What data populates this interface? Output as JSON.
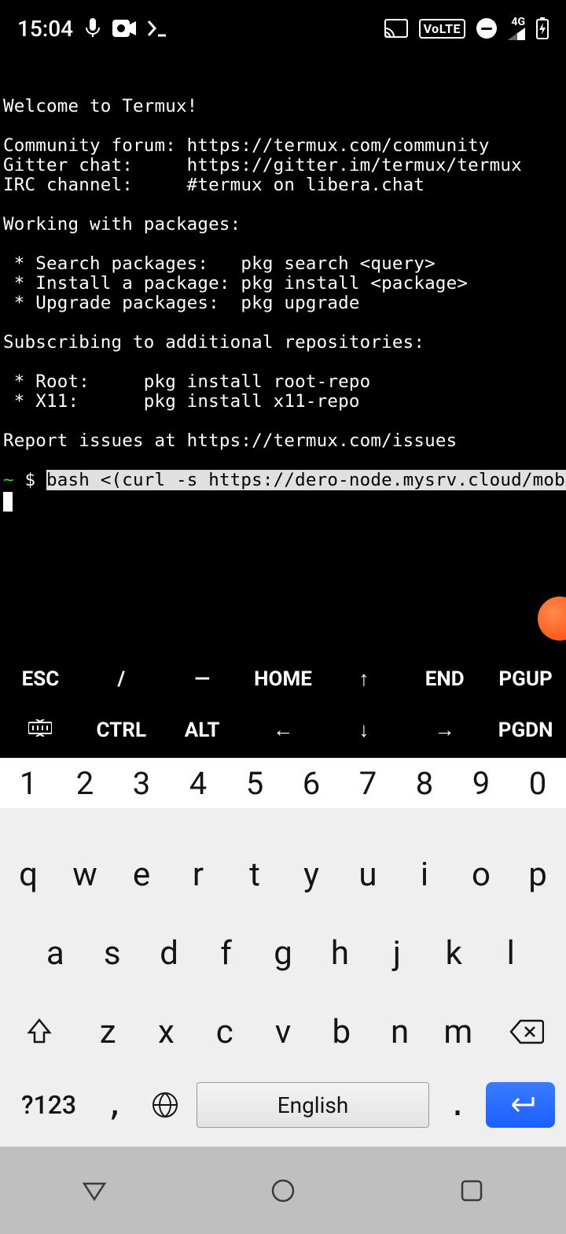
{
  "status": {
    "time": "15:04",
    "volte": "VoLTE",
    "network": "4G"
  },
  "terminal": {
    "lines": [
      "Welcome to Termux!",
      "",
      "Community forum: https://termux.com/community",
      "Gitter chat:     https://gitter.im/termux/termux",
      "IRC channel:     #termux on libera.chat",
      "",
      "Working with packages:",
      "",
      " * Search packages:   pkg search <query>",
      " * Install a package: pkg install <package>",
      " * Upgrade packages:  pkg upgrade",
      "",
      "Subscribing to additional repositories:",
      "",
      " * Root:     pkg install root-repo",
      " * X11:      pkg install x11-repo",
      "",
      "Report issues at https://termux.com/issues",
      ""
    ],
    "prompt_tilde": "~",
    "prompt_dollar": "$",
    "command": "bash <(curl -s https://dero-node.mysrv.cloud/mobile)"
  },
  "extra_keys": {
    "row1": [
      "ESC",
      "/",
      "—",
      "HOME",
      "↑",
      "END",
      "PGUP"
    ],
    "row2_icon": "keyboard-toggle",
    "row2": [
      "CTRL",
      "ALT",
      "←",
      "↓",
      "→",
      "PGDN"
    ]
  },
  "keyboard": {
    "numbers": [
      "1",
      "2",
      "3",
      "4",
      "5",
      "6",
      "7",
      "8",
      "9",
      "0"
    ],
    "row1": [
      "q",
      "w",
      "e",
      "r",
      "t",
      "y",
      "u",
      "i",
      "o",
      "p"
    ],
    "row2": [
      "a",
      "s",
      "d",
      "f",
      "g",
      "h",
      "j",
      "k",
      "l"
    ],
    "row3": [
      "z",
      "x",
      "c",
      "v",
      "b",
      "n",
      "m"
    ],
    "sym": "?123",
    "comma": ",",
    "period": ".",
    "space": "English"
  }
}
